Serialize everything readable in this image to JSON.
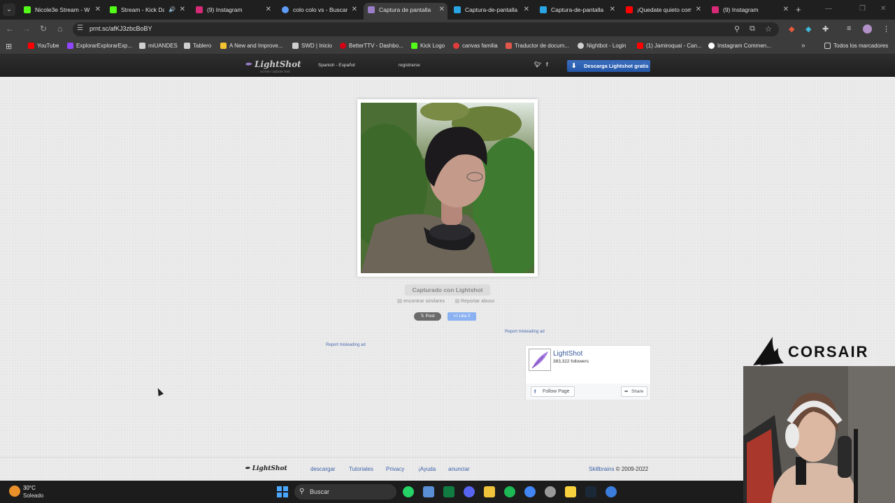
{
  "tabs": [
    {
      "label": "Nicole3e Stream - W",
      "color": "#53fc18"
    },
    {
      "label": "Stream - Kick Da",
      "color": "#53fc18"
    },
    {
      "label": "(9) Instagram",
      "color": "#d62976"
    },
    {
      "label": "colo colo vs - Buscar",
      "color": "#5f9cf7"
    },
    {
      "label": "Captura de pantalla",
      "color": "#9a7ec8"
    },
    {
      "label": "Captura-de-pantalla",
      "color": "#2aa5e4"
    },
    {
      "label": "Captura-de-pantalla",
      "color": "#2aa5e4"
    },
    {
      "label": "¡Quedate quieto com",
      "color": "#ff0000"
    },
    {
      "label": "(9) Instagram",
      "color": "#d62976"
    }
  ],
  "address": {
    "url": "prnt.sc/afKJ3zbcBoBY"
  },
  "bookmarks": [
    {
      "label": "YouTube",
      "color": "#ff0000"
    },
    {
      "label": "ExplorarExplorarExp...",
      "color": "#9146ff"
    },
    {
      "label": "miUANDES",
      "color": "#cfcfcf"
    },
    {
      "label": "Tablero",
      "color": "#cfcfcf"
    },
    {
      "label": "A New and Improve...",
      "color": "#f4c430"
    },
    {
      "label": "SWD | Inicio",
      "color": "#cfcfcf"
    },
    {
      "label": "BetterTTV - Dashbo...",
      "color": "#d50014"
    },
    {
      "label": "Kick Logo",
      "color": "#53fc18"
    },
    {
      "label": "canvas familia",
      "color": "#e13c3c"
    },
    {
      "label": "Traductor de docum...",
      "color": "#e2574c"
    },
    {
      "label": "Nightbot - Login",
      "color": "#cfcfcf"
    },
    {
      "label": "(1) Jamiroquai - Can...",
      "color": "#ff0000"
    },
    {
      "label": "Instagram Commen...",
      "color": "#ffffff"
    }
  ],
  "bookmarks_all": "Todos los marcadores",
  "lightshot": {
    "logo": "LightShot",
    "logo_sub": "screen capture tool",
    "language": "Spanish - Español",
    "register": "registrarse",
    "download": "Descarga Lightshot gratis",
    "captured": "Capturado con Lightshot",
    "find_similar": "encontrar similares",
    "report_abuse": "Reportar abuso",
    "x_post": "Post",
    "fb_like": "Like 0",
    "report_ad_1": "Report misleading ad",
    "report_ad_2": "Report misleading ad"
  },
  "fb_widget": {
    "name": "LightShot",
    "followers": "383,322 followers",
    "follow": "Follow Page",
    "share": "Share"
  },
  "footer": {
    "logo": "LightShot",
    "links": [
      "descargar",
      "Tutoriales",
      "Privacy",
      "¡Ayuda",
      "anunciar"
    ],
    "brand": "Skillbrains",
    "copy": "© 2009-2022"
  },
  "overlay": {
    "sponsor": "CORSAIR"
  },
  "taskbar": {
    "temp": "30°C",
    "condition": "Soleado",
    "search": "Buscar"
  }
}
